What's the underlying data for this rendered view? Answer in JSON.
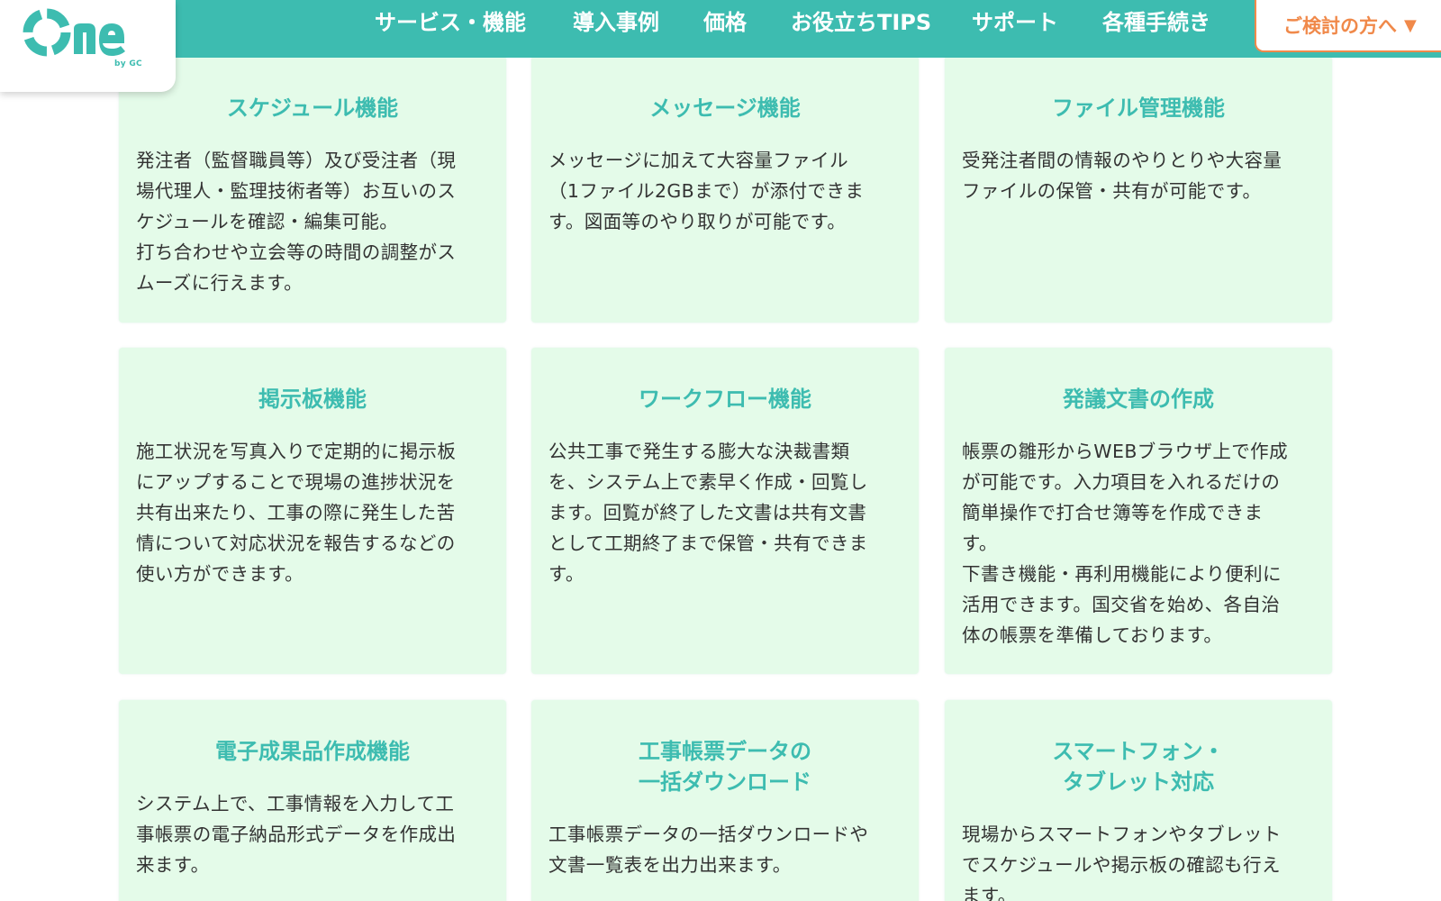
{
  "brand": {
    "logo_text": "One",
    "logo_sub": "by GC"
  },
  "nav": {
    "items": [
      "サービス・機能",
      "導入事例",
      "価格",
      "お役立ちTIPS",
      "サポート",
      "各種手続き"
    ],
    "cta_label": "ご検討の方へ",
    "cta_icon": "triangle-down-icon"
  },
  "colors": {
    "primary": "#3dbcb0",
    "card_bg": "#e4fbe9",
    "accent": "#f0894a",
    "text": "#333333"
  },
  "features": [
    {
      "title": "スケジュール機能",
      "body": "発注者（監督職員等）及び受注者（現\n場代理人・監理技術者等）お互いのス\nケジュールを確認・編集可能。\n打ち合わせや立会等の時間の調整がス\nムーズに行えます。"
    },
    {
      "title": "メッセージ機能",
      "body": "メッセージに加えて大容量ファイル\n（1ファイル2GBまで）が添付できま\nす。図面等のやり取りが可能です。"
    },
    {
      "title": "ファイル管理機能",
      "body": "受発注者間の情報のやりとりや大容量\nファイルの保管・共有が可能です。"
    },
    {
      "title": "掲示板機能",
      "body": "施工状況を写真入りで定期的に掲示板\nにアップすることで現場の進捗状況を\n共有出来たり、工事の際に発生した苦\n情について対応状況を報告するなどの\n使い方ができます。"
    },
    {
      "title": "ワークフロー機能",
      "body": "公共工事で発生する膨大な決裁書類\nを、システム上で素早く作成・回覧し\nます。回覧が終了した文書は共有文書\nとして工期終了まで保管・共有できま\nす。"
    },
    {
      "title": "発議文書の作成",
      "body": "帳票の雛形からWEBブラウザ上で作成\nが可能です。入力項目を入れるだけの\n簡単操作で打合せ簿等を作成できま\nす。\n下書き機能・再利用機能により便利に\n活用できます。国交省を始め、各自治\n体の帳票を準備しております。"
    },
    {
      "title": "電子成果品作成機能",
      "body": "システム上で、工事情報を入力して工\n事帳票の電子納品形式データを作成出\n来ます。"
    },
    {
      "title": "工事帳票データの\n一括ダウンロード",
      "body": "工事帳票データの一括ダウンロードや\n文書一覧表を出力出来ます。"
    },
    {
      "title": "スマートフォン・\nタブレット対応",
      "body": "現場からスマートフォンやタブレット\nでスケジュールや掲示板の確認も行え\nます。"
    }
  ]
}
